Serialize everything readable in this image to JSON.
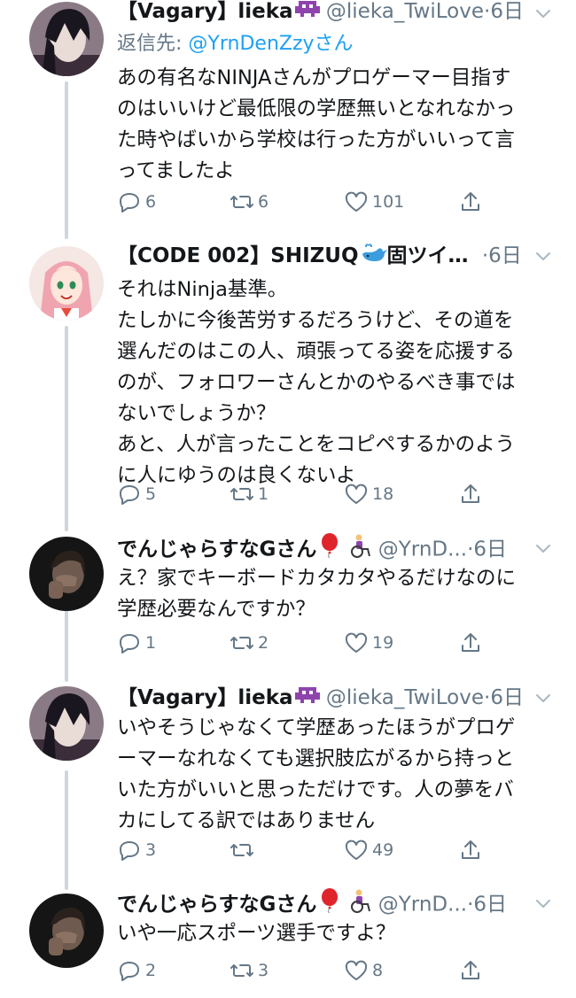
{
  "tweets": [
    {
      "name": "【Vagary】lieka",
      "emoji": "alien-monster-emoji",
      "handle": "@lieka_TwiLove",
      "time": "·6日",
      "reply_to_label": "返信先:",
      "reply_to_handle": "@YrnDenZzyさん",
      "lines": [
        "あの有名なNINJAさんがプロゲーマー目指す",
        "のはいいけど最低限の学歴無いとなれなかっ",
        "た時やばいから学校は行った方がいいって言",
        "ってましたよ"
      ],
      "replies": "6",
      "retweets": "6",
      "likes": "101"
    },
    {
      "name": "【CODE 002】SHIZUQ",
      "emoji": "whale-emoji",
      "name_suffix": "固ツイ…",
      "handle": "",
      "time": "·6日",
      "lines": [
        "それはNinja基準。",
        "たしかに今後苦労するだろうけど、その道を",
        "選んだのはこの人、頑張ってる姿を応援する",
        "のが、フォロワーさんとかのやるべき事では",
        "ないでしょうか？",
        "あと、人が言ったことをコピペするかのよう",
        "に人にゆうのは良くないよ"
      ],
      "replies": "5",
      "retweets": "1",
      "likes": "18"
    },
    {
      "name": "でんじゃらすなGさん",
      "emoji": "balloon-and-wheelchair-emoji",
      "handle": "@YrnD...",
      "time": "·6日",
      "lines": [
        "え？家でキーボードカタカタやるだけなのに",
        "学歴必要なんですか？"
      ],
      "replies": "1",
      "retweets": "2",
      "likes": "19"
    },
    {
      "name": "【Vagary】lieka",
      "emoji": "alien-monster-emoji",
      "handle": "@lieka_TwiLove",
      "time": "·6日",
      "lines": [
        "いやそうじゃなくて学歴あったほうがプロゲ",
        "ーマーなれなくても選択肢広がるから持っと",
        "いた方がいいと思っただけです。人の夢をバ",
        "カにしてる訳ではありません"
      ],
      "replies": "3",
      "retweets": "",
      "likes": "49"
    },
    {
      "name": "でんじゃらすなGさん",
      "emoji": "balloon-and-wheelchair-emoji",
      "handle": "@YrnD...",
      "time": "·6日",
      "lines": [
        "いや一応スポーツ選手ですよ？"
      ],
      "replies": "2",
      "retweets": "3",
      "likes": "8"
    }
  ],
  "colors": {
    "text": "#14171a",
    "secondary": "#657786",
    "link": "#1da1f2",
    "thread_line": "#ccd6dd"
  }
}
